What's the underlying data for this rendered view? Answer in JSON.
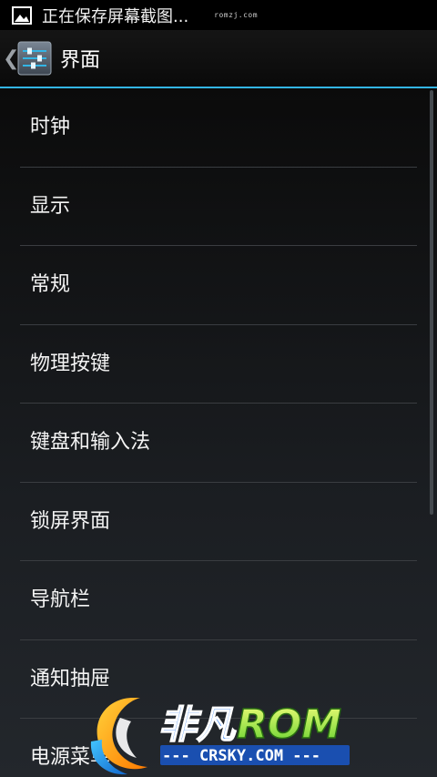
{
  "status_bar": {
    "notification_text": "正在保存屏幕截图...",
    "watermark_text": "romzj.com"
  },
  "action_bar": {
    "title": "界面",
    "back_icon": "chevron-left-icon",
    "app_icon": "settings-sliders-icon"
  },
  "menu": {
    "items": [
      {
        "label": "时钟"
      },
      {
        "label": "显示"
      },
      {
        "label": "常规"
      },
      {
        "label": "物理按键"
      },
      {
        "label": "键盘和输入法"
      },
      {
        "label": "锁屏界面"
      },
      {
        "label": "导航栏"
      },
      {
        "label": "通知抽屉"
      },
      {
        "label": "电源菜单"
      }
    ]
  },
  "watermark": {
    "brand_cn": "非凡",
    "brand_en": "ROM",
    "site": "--- CRSKY.COM ---"
  },
  "colors": {
    "accent": "#33b5e5",
    "divider": "#3a3d41",
    "background": "#000000"
  }
}
